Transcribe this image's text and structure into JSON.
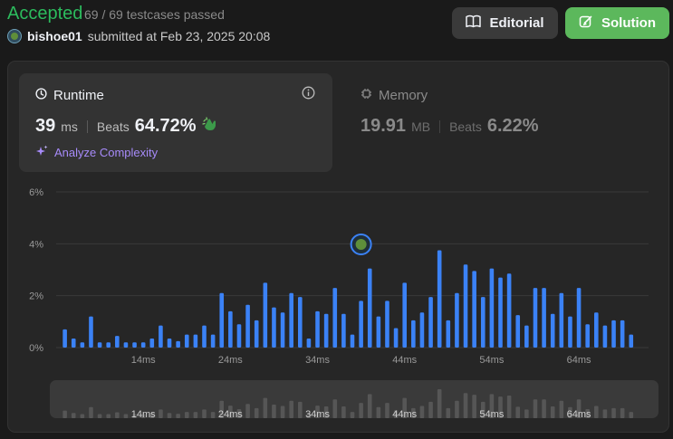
{
  "header": {
    "status": "Accepted",
    "testcases": "69 / 69 testcases passed",
    "username": "bishoe01",
    "submitted_text": "submitted at Feb 23, 2025 20:08",
    "editorial_label": "Editorial",
    "solution_label": "Solution"
  },
  "runtime": {
    "title": "Runtime",
    "value": "39",
    "unit": "ms",
    "beats_label": "Beats",
    "beats_value": "64.72%",
    "analyze_label": "Analyze Complexity"
  },
  "memory": {
    "title": "Memory",
    "value": "19.91",
    "unit": "MB",
    "beats_label": "Beats",
    "beats_value": "6.22%"
  },
  "colors": {
    "accepted": "#2cbb5d",
    "bar": "#3b82f6",
    "solution_button": "#5cb85c",
    "analyze": "#a78bfa"
  },
  "chart_data": {
    "type": "bar",
    "y_ticks": [
      "6%",
      "4%",
      "2%",
      "0%"
    ],
    "x_ticks": [
      "14ms",
      "24ms",
      "34ms",
      "44ms",
      "54ms",
      "64ms"
    ],
    "ylim": [
      0,
      6
    ],
    "xlim": [
      4,
      72
    ],
    "user_marker_x": 39,
    "x": [
      5,
      6,
      7,
      8,
      9,
      10,
      11,
      12,
      13,
      14,
      15,
      16,
      17,
      18,
      19,
      20,
      21,
      22,
      23,
      24,
      25,
      26,
      27,
      28,
      29,
      30,
      31,
      32,
      33,
      34,
      35,
      36,
      37,
      38,
      39,
      40,
      41,
      42,
      43,
      44,
      45,
      46,
      47,
      48,
      49,
      50,
      51,
      52,
      53,
      54,
      55,
      56,
      57,
      58,
      59,
      60,
      61,
      62,
      63,
      64,
      65,
      66,
      67,
      68,
      69,
      70
    ],
    "values": [
      0.7,
      0.35,
      0.2,
      1.2,
      0.2,
      0.2,
      0.45,
      0.2,
      0.2,
      0.2,
      0.35,
      0.85,
      0.35,
      0.25,
      0.5,
      0.5,
      0.85,
      0.5,
      2.1,
      1.4,
      0.9,
      1.65,
      1.05,
      2.5,
      1.55,
      1.35,
      2.1,
      1.95,
      0.35,
      1.4,
      1.3,
      2.3,
      1.3,
      0.5,
      1.8,
      3.05,
      1.2,
      1.8,
      0.75,
      2.5,
      1.05,
      1.35,
      1.95,
      3.75,
      1.05,
      2.1,
      3.2,
      2.95,
      1.95,
      3.05,
      2.7,
      2.85,
      1.25,
      0.85,
      2.3,
      2.3,
      1.3,
      2.1,
      1.2,
      2.3,
      0.9,
      1.35,
      0.85,
      1.05,
      1.05,
      0.5
    ]
  }
}
